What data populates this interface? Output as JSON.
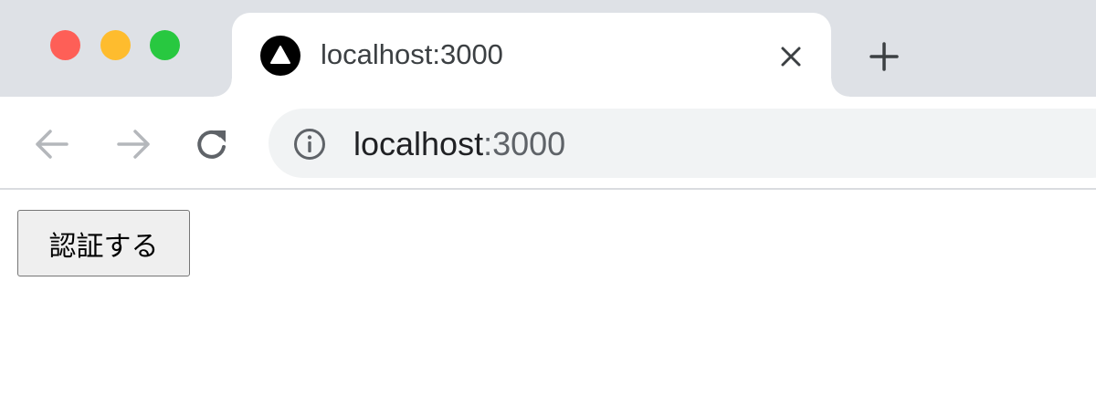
{
  "window": {
    "traffic_lights": [
      "close",
      "minimize",
      "zoom"
    ]
  },
  "tab": {
    "favicon": "triangle-logo-icon",
    "title": "localhost:3000",
    "close_icon": "close-icon"
  },
  "new_tab_icon": "plus-icon",
  "toolbar": {
    "back_icon": "arrow-left-icon",
    "forward_icon": "arrow-right-icon",
    "reload_icon": "reload-icon"
  },
  "address_bar": {
    "info_icon": "info-icon",
    "host": "localhost",
    "port": ":3000"
  },
  "page": {
    "button_label": "認証する"
  },
  "colors": {
    "tabstrip": "#dee1e6",
    "red": "#fe5f57",
    "yellow": "#febc2e",
    "green": "#28c840",
    "omnibox": "#f1f3f4"
  }
}
